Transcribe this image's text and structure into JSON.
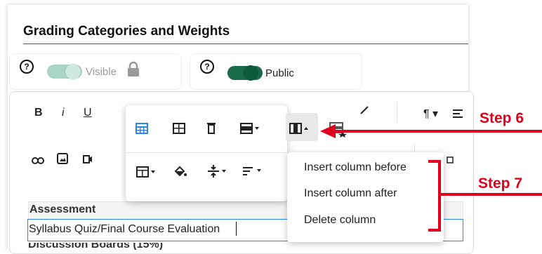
{
  "section": {
    "title": "Grading Categories and Weights"
  },
  "visibility": {
    "help_glyph": "?",
    "visible_label": "Visible",
    "public_label": "Public"
  },
  "toolbar": {
    "bold": "B",
    "italic": "i",
    "underline": "U",
    "paragraph": "¶ ▾",
    "more_chevron": "▾"
  },
  "popup": {
    "icons": [
      "table-properties-icon",
      "cell-properties-icon",
      "delete-table-icon",
      "row-menu-icon",
      "column-menu-icon",
      "table-star-icon",
      "cell-menu-icon",
      "fill-color-icon",
      "vertical-align-icon",
      "horizontal-align-icon"
    ]
  },
  "column_menu": {
    "items": [
      "Insert column before",
      "Insert column after",
      "Delete column"
    ]
  },
  "table": {
    "header": "Assessment",
    "row1": "Syllabus Quiz/Final Course Evaluation"
  },
  "annotations": {
    "step6": "Step 6",
    "step7": "Step 7",
    "accent_color": "#e0001b"
  },
  "colors": {
    "toggle_on": "#1a6b4a",
    "toggle_off": "#a8d5c5",
    "table_select": "#2c86e8"
  }
}
